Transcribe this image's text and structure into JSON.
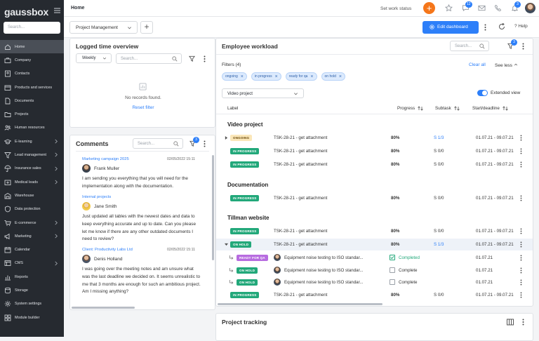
{
  "app": {
    "logo": "gaussbox"
  },
  "sidebar": {
    "search_placeholder": "Search...",
    "items": [
      {
        "label": "Home",
        "icon": "home-icon",
        "active": true,
        "chevron": false
      },
      {
        "label": "Company",
        "icon": "briefcase-icon",
        "chevron": false
      },
      {
        "label": "Contacts",
        "icon": "contacts-icon",
        "chevron": false
      },
      {
        "label": "Products and services",
        "icon": "box-icon",
        "chevron": false
      },
      {
        "label": "Documents",
        "icon": "document-icon",
        "chevron": false
      },
      {
        "label": "Projects",
        "icon": "folder-icon",
        "chevron": false
      },
      {
        "label": "Human resources",
        "icon": "people-icon",
        "chevron": false
      },
      {
        "label": "E-learning",
        "icon": "graduation-icon",
        "chevron": true
      },
      {
        "label": "Lead management",
        "icon": "funnel-icon",
        "chevron": true
      },
      {
        "label": "Insurance sales",
        "icon": "umbrella-icon",
        "chevron": true
      },
      {
        "label": "Medical leads",
        "icon": "medical-icon",
        "chevron": true
      },
      {
        "label": "Warehouse",
        "icon": "warehouse-icon",
        "chevron": false
      },
      {
        "label": "Data protection",
        "icon": "shield-icon",
        "chevron": false
      },
      {
        "label": "E-commerce",
        "icon": "cart-icon",
        "chevron": true
      },
      {
        "label": "Marketing",
        "icon": "megaphone-icon",
        "chevron": true
      },
      {
        "label": "Calendar",
        "icon": "calendar-icon",
        "chevron": false
      },
      {
        "label": "CMS",
        "icon": "cms-icon",
        "chevron": true
      },
      {
        "label": "Reports",
        "icon": "chart-icon",
        "chevron": false
      },
      {
        "label": "Storage",
        "icon": "storage-icon",
        "chevron": false
      },
      {
        "label": "System settings",
        "icon": "gear-icon",
        "chevron": false
      },
      {
        "label": "Module builder",
        "icon": "builder-icon",
        "chevron": false
      }
    ]
  },
  "topbar": {
    "title": "Home",
    "status": "Set work status",
    "chat_badge": "12",
    "bell_badge": "3"
  },
  "toolbar": {
    "dashboard": "Project Management",
    "edit_label": "Edit dashboard",
    "help_label": "Help"
  },
  "logged_time": {
    "title": "Logged time overview",
    "period": "Weekly",
    "search_placeholder": "Search...",
    "empty_text": "No records found.",
    "reset_label": "Reset filter"
  },
  "comments": {
    "title": "Comments",
    "search_placeholder": "Search...",
    "filter_badge": "3",
    "items": [
      {
        "title": "Marketing campaign 2025",
        "date": "02/05/2022 15:11",
        "author": "Frank Muller",
        "text": "I am sending you everything that you will need for the implementation along with the documentation."
      },
      {
        "title": "Internal projects",
        "date": "02/05/2022 15:11",
        "author": "Jane Smith",
        "text": "Just updated all tables with the newest dates and data to keep everything accurate and up to date. Can you please let me know if there are any other outdated documents I need to review?"
      },
      {
        "title": "Client: Productivity Labs Ltd",
        "date": "02/05/2022 15:11",
        "author": "Denis Holland",
        "text": "I was going over the meeting notes and am unsure what was the last deadline we decided on. It seems unrealistic to me that 3 months are enough for such an ambitious project. Am I missing anything?"
      }
    ]
  },
  "workload": {
    "title": "Employee workload",
    "search_placeholder": "Search...",
    "filter_badge": "3",
    "filters_label": "Filters (4)",
    "clear_label": "Clear all",
    "see_less_label": "See less",
    "chips": [
      "ongoing",
      "in progress",
      "ready for qa",
      "on hold"
    ],
    "project_select": "Video project",
    "extended_label": "Extended view",
    "columns": {
      "label": "Label",
      "progress": "Progress",
      "subtask": "Subtask",
      "date": "Start/deadline"
    },
    "sections": [
      {
        "name": "Video project",
        "rows": [
          {
            "status": "ONGOING",
            "cls": "ongoing",
            "task": "TSK-28-21 - get attachment",
            "pct": "80%",
            "sub": "1/3",
            "link": true,
            "date": "01.07.21 - 09.07.21",
            "arrow": "right"
          },
          {
            "status": "IN PROGRESS",
            "cls": "inprog",
            "task": "TSK-28-21 - get attachment",
            "pct": "80%",
            "sub": "0/0",
            "date": "01.07.21 - 09.07.21"
          },
          {
            "status": "IN PROGRESS",
            "cls": "inprog",
            "task": "TSK-28-21 - get attachment",
            "pct": "80%",
            "sub": "0/0",
            "date": "01.07.21 - 09.07.21"
          }
        ]
      },
      {
        "name": "Documentation",
        "rows": [
          {
            "status": "IN PROGRESS",
            "cls": "inprog",
            "task": "TSK-28-21 - get attachment",
            "pct": "80%",
            "sub": "0/0",
            "date": "01.07.21 - 09.07.21"
          }
        ]
      },
      {
        "name": "Tillman website",
        "rows": [
          {
            "status": "IN PROGRESS",
            "cls": "inprog",
            "task": "TSK-28-21 - get attachment",
            "pct": "80%",
            "sub": "0/0",
            "date": "01.07.21 - 09.07.21"
          },
          {
            "status": "ON HOLD",
            "cls": "onhold",
            "task": "TSK-28-21 - get attachment",
            "pct": "80%",
            "sub": "1/3",
            "link": true,
            "date": "01.07.21 - 09.07.21",
            "arrow": "down",
            "sel": true
          }
        ]
      }
    ],
    "subtasks": [
      {
        "status": "READY FOR QA",
        "cls": "ready",
        "task": "Equipment noise testing to ISO standar...",
        "check": true,
        "state": "Completed",
        "date": "01.07.21"
      },
      {
        "status": "ON HOLD",
        "cls": "onhold",
        "task": "Equipment noise testing to ISO standar...",
        "check": false,
        "state": "Complete",
        "date": "01.07.21"
      },
      {
        "status": "ON HOLD",
        "cls": "onhold",
        "task": "Equipment noise testing to ISO standar...",
        "check": false,
        "state": "Complete",
        "date": "01.07.21"
      }
    ],
    "last_row": {
      "status": "IN PROGRESS",
      "cls": "inprog",
      "task": "TSK-28-21 - get attachment",
      "pct": "80%",
      "sub": "0/0",
      "date": "01.07.21 - 09.07.21"
    }
  },
  "tracking": {
    "title": "Project tracking"
  }
}
